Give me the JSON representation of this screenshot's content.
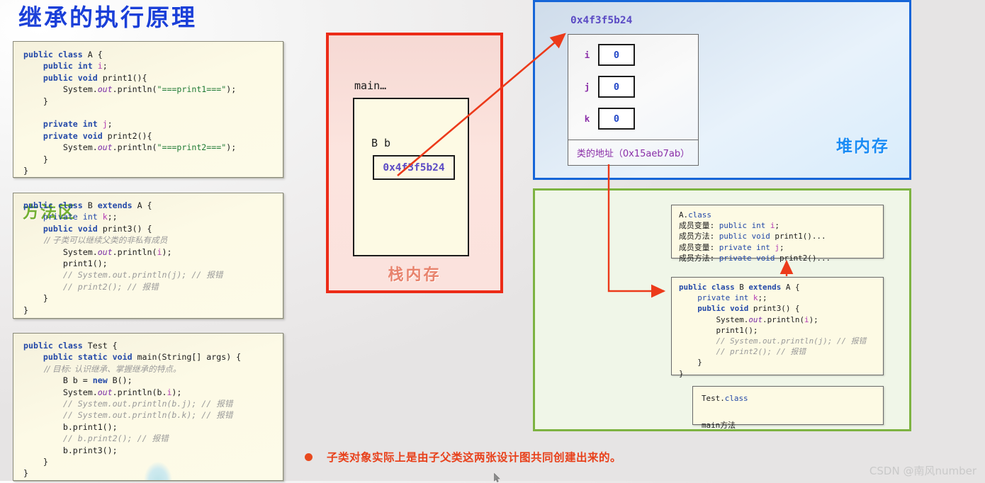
{
  "slide": {
    "title": "继承的执行原理"
  },
  "code_blocks": [
    {
      "name": "class-a",
      "lines": [
        [
          {
            "t": "public class ",
            "c": "kw"
          },
          {
            "t": "A {",
            "c": "id"
          }
        ],
        [
          {
            "t": "    public int ",
            "c": "kw"
          },
          {
            "t": "i",
            "c": "fld2"
          },
          {
            "t": ";",
            "c": "id"
          }
        ],
        [
          {
            "t": "    public void ",
            "c": "kw"
          },
          {
            "t": "print1",
            "c": "id"
          },
          {
            "t": "(){",
            "c": "id"
          }
        ],
        [
          {
            "t": "        System.",
            "c": "id"
          },
          {
            "t": "out",
            "c": "mem"
          },
          {
            "t": ".println(",
            "c": "id"
          },
          {
            "t": "\"===print1===\"",
            "c": "str"
          },
          {
            "t": ");",
            "c": "id"
          }
        ],
        [
          {
            "t": "    }",
            "c": "id"
          }
        ],
        [
          {
            "t": "",
            "c": "id"
          }
        ],
        [
          {
            "t": "    private int ",
            "c": "kw"
          },
          {
            "t": "j",
            "c": "fld2"
          },
          {
            "t": ";",
            "c": "id"
          }
        ],
        [
          {
            "t": "    private void ",
            "c": "kw"
          },
          {
            "t": "print2",
            "c": "id"
          },
          {
            "t": "(){",
            "c": "id"
          }
        ],
        [
          {
            "t": "        System.",
            "c": "id"
          },
          {
            "t": "out",
            "c": "mem"
          },
          {
            "t": ".println(",
            "c": "id"
          },
          {
            "t": "\"===print2===\"",
            "c": "str"
          },
          {
            "t": ");",
            "c": "id"
          }
        ],
        [
          {
            "t": "    }",
            "c": "id"
          }
        ],
        [
          {
            "t": "}",
            "c": "id"
          }
        ]
      ]
    },
    {
      "name": "class-b",
      "lines": [
        [
          {
            "t": "public class ",
            "c": "kw"
          },
          {
            "t": "B ",
            "c": "id"
          },
          {
            "t": "extends ",
            "c": "kw"
          },
          {
            "t": "A {",
            "c": "id"
          }
        ],
        [
          {
            "t": "    private int ",
            "c": "kw2"
          },
          {
            "t": "k",
            "c": "fld2"
          },
          {
            "t": ";;",
            "c": "id"
          }
        ],
        [
          {
            "t": "    public void ",
            "c": "kw"
          },
          {
            "t": "print3",
            "c": "id"
          },
          {
            "t": "() {",
            "c": "id"
          }
        ],
        [
          {
            "t": "        // 子类可以继续父类的非私有成员",
            "c": "cmtz"
          }
        ],
        [
          {
            "t": "        System.",
            "c": "id"
          },
          {
            "t": "out",
            "c": "mem"
          },
          {
            "t": ".println(",
            "c": "id"
          },
          {
            "t": "i",
            "c": "fld2"
          },
          {
            "t": ");",
            "c": "id"
          }
        ],
        [
          {
            "t": "        print1();",
            "c": "id"
          }
        ],
        [
          {
            "t": "        // System.out.println(j); // 报错",
            "c": "cmt"
          }
        ],
        [
          {
            "t": "        // print2(); // 报错",
            "c": "cmt"
          }
        ],
        [
          {
            "t": "    }",
            "c": "id"
          }
        ],
        [
          {
            "t": "}",
            "c": "id"
          }
        ]
      ]
    },
    {
      "name": "class-test",
      "lines": [
        [
          {
            "t": "public class ",
            "c": "kw"
          },
          {
            "t": "Test {",
            "c": "id"
          }
        ],
        [
          {
            "t": "    public static void ",
            "c": "kw"
          },
          {
            "t": "main",
            "c": "id"
          },
          {
            "t": "(String[] args) {",
            "c": "id"
          }
        ],
        [
          {
            "t": "        // 目标: 认识继承、掌握继承的特点。",
            "c": "cmtz"
          }
        ],
        [
          {
            "t": "        B b = ",
            "c": "id"
          },
          {
            "t": "new ",
            "c": "kw"
          },
          {
            "t": "B();",
            "c": "id"
          }
        ],
        [
          {
            "t": "        System.",
            "c": "id"
          },
          {
            "t": "out",
            "c": "mem"
          },
          {
            "t": ".println(b.",
            "c": "id"
          },
          {
            "t": "i",
            "c": "fld2"
          },
          {
            "t": ");",
            "c": "id"
          }
        ],
        [
          {
            "t": "        // System.out.println(b.j); // 报错",
            "c": "cmt"
          }
        ],
        [
          {
            "t": "        // System.out.println(b.k); // 报错",
            "c": "cmt"
          }
        ],
        [
          {
            "t": "        b.print1();",
            "c": "id"
          }
        ],
        [
          {
            "t": "        // b.print2(); // 报错",
            "c": "cmt"
          }
        ],
        [
          {
            "t": "        b.print3();",
            "c": "id"
          }
        ],
        [
          {
            "t": "    }",
            "c": "id"
          }
        ],
        [
          {
            "t": "}",
            "c": "id"
          }
        ]
      ]
    }
  ],
  "stack": {
    "label": "栈内存",
    "frame_label": "main…",
    "variable_type_name": "B  b",
    "variable_value": "0x4f3f5b24"
  },
  "heap": {
    "label": "堆内存",
    "object_address": "0x4f3f5b24",
    "fields": [
      {
        "name": "i",
        "value": "0"
      },
      {
        "name": "j",
        "value": "0"
      },
      {
        "name": "k",
        "value": "0"
      }
    ],
    "class_address_label": "类的地址（0x15aeb7ab）"
  },
  "method_area": {
    "label": "方法区",
    "a_class": {
      "lines": [
        [
          {
            "t": "A.",
            "c": "id"
          },
          {
            "t": "class",
            "c": "kw2"
          }
        ],
        [
          {
            "t": "成员变量",
            "c": "zh"
          },
          {
            "t": ": ",
            "c": "id"
          },
          {
            "t": "public int ",
            "c": "kw2"
          },
          {
            "t": "i",
            "c": "fld2"
          },
          {
            "t": ";",
            "c": "id"
          }
        ],
        [
          {
            "t": "成员方法",
            "c": "zh"
          },
          {
            "t": ": ",
            "c": "id"
          },
          {
            "t": "public void ",
            "c": "kw2"
          },
          {
            "t": "print1()...",
            "c": "id"
          }
        ],
        [
          {
            "t": "成员变量",
            "c": "zh"
          },
          {
            "t": ": ",
            "c": "id"
          },
          {
            "t": "private int ",
            "c": "kw2"
          },
          {
            "t": "j",
            "c": "fld2"
          },
          {
            "t": ";",
            "c": "id"
          }
        ],
        [
          {
            "t": "成员方法",
            "c": "zh"
          },
          {
            "t": ": ",
            "c": "id"
          },
          {
            "t": "private void ",
            "c": "kw2"
          },
          {
            "t": "print2()...",
            "c": "id"
          }
        ]
      ]
    },
    "b_class": {
      "lines": [
        [
          {
            "t": "public class ",
            "c": "kw"
          },
          {
            "t": "B ",
            "c": "id"
          },
          {
            "t": "extends ",
            "c": "kw"
          },
          {
            "t": "A {",
            "c": "id"
          }
        ],
        [
          {
            "t": "    private int ",
            "c": "kw2"
          },
          {
            "t": "k",
            "c": "fld2"
          },
          {
            "t": ";;",
            "c": "id"
          }
        ],
        [
          {
            "t": "    public void ",
            "c": "kw"
          },
          {
            "t": "print3",
            "c": "id"
          },
          {
            "t": "() {",
            "c": "id"
          }
        ],
        [
          {
            "t": "        System.",
            "c": "id"
          },
          {
            "t": "out",
            "c": "mem"
          },
          {
            "t": ".println(",
            "c": "id"
          },
          {
            "t": "i",
            "c": "fld2"
          },
          {
            "t": ");",
            "c": "id"
          }
        ],
        [
          {
            "t": "        print1();",
            "c": "id"
          }
        ],
        [
          {
            "t": "        // System.out.println(j); // 报错",
            "c": "cmt"
          }
        ],
        [
          {
            "t": "        // print2(); // 报错",
            "c": "cmt"
          }
        ],
        [
          {
            "t": "    }",
            "c": "id"
          }
        ],
        [
          {
            "t": "}",
            "c": "id"
          }
        ]
      ]
    },
    "test_class": {
      "lines": [
        [
          {
            "t": "Test.",
            "c": "id"
          },
          {
            "t": "class",
            "c": "kw2"
          }
        ],
        [
          {
            "t": "",
            "c": "id"
          }
        ],
        [
          {
            "t": "main",
            "c": "id"
          },
          {
            "t": "方法",
            "c": "zh"
          }
        ]
      ]
    }
  },
  "bottom_note": {
    "text": "子类对象实际上是由子父类这两张设计图共同创建出来的。"
  },
  "watermark": {
    "text": "CSDN @南风number"
  },
  "colors": {
    "title_blue": "#1a3fd8",
    "stack_border_red": "#ec2b17",
    "stack_label": "#e8836d",
    "heap_border_blue": "#1565d8",
    "heap_label": "#1a8cf5",
    "method_border_green": "#7db341",
    "method_label": "#74b032",
    "arrow_red": "#ec3a1a",
    "note_red": "#e8401a",
    "code_bg": "#fdfae4"
  }
}
